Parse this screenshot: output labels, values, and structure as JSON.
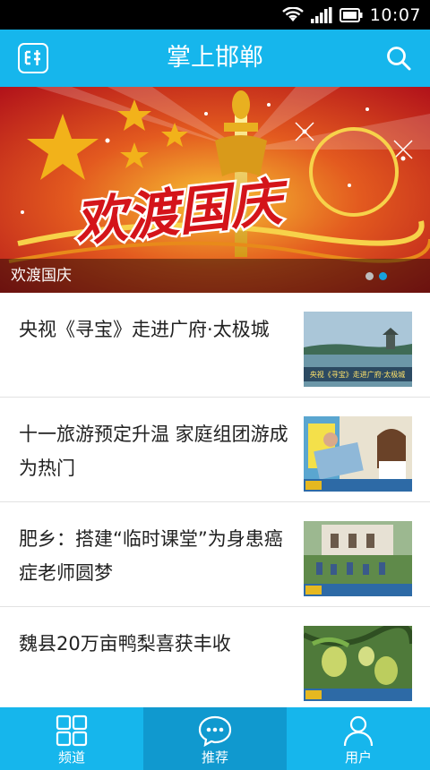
{
  "status_bar": {
    "time": "10:07",
    "icons": [
      "wifi-icon",
      "signal-icon",
      "battery-icon"
    ]
  },
  "header": {
    "title": "掌上邯郸",
    "logo_icon": "app-logo-icon",
    "search_icon": "search-icon"
  },
  "banner": {
    "caption": "欢渡国庆",
    "artwork_text": "欢渡国庆",
    "slide_count": 2,
    "active_slide": 2
  },
  "news": [
    {
      "headline": "央视《寻宝》走进广府·太极城",
      "thumb_caption": "央视《寻宝》走进广府·太极城"
    },
    {
      "headline": "十一旅游预定升温 家庭组团游成为热门",
      "thumb_caption": ""
    },
    {
      "headline": "肥乡：搭建“临时课堂”为身患癌症老师圆梦",
      "thumb_caption": ""
    },
    {
      "headline": "魏县20万亩鸭梨喜获丰收",
      "thumb_caption": ""
    }
  ],
  "bottom_nav": [
    {
      "label": "频道",
      "icon": "grid-icon",
      "active": false
    },
    {
      "label": "推荐",
      "icon": "chat-bubble-icon",
      "active": true
    },
    {
      "label": "用户",
      "icon": "user-icon",
      "active": false
    }
  ],
  "colors": {
    "primary": "#16b6ec",
    "nav_active": "#1099cf",
    "indicator_active": "#16a2dd"
  }
}
